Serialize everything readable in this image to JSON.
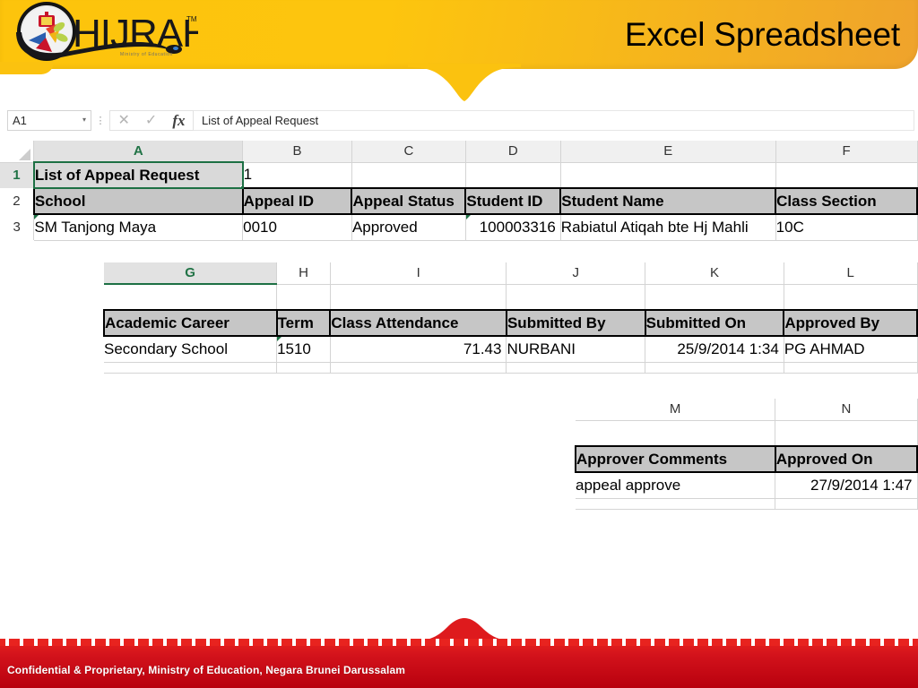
{
  "header": {
    "logo_text": "HIJRAH",
    "logo_tagline": "Ministry of Education",
    "logo_tm": "TM",
    "title": "Excel Spreadsheet",
    "bg_color_left": "#FDC40C",
    "bg_color_right": "#EFA32C"
  },
  "formula_bar": {
    "name_box_value": "A1",
    "name_box_caret": "▾",
    "dots_icon": "vertical-dots-icon",
    "cancel_icon": "✕",
    "enter_icon": "✓",
    "fx_icon": "fx",
    "formula_value": "List of Appeal Request"
  },
  "block1": {
    "column_headers": [
      "A",
      "B",
      "C",
      "D",
      "E",
      "F"
    ],
    "active_column": "A",
    "row_headers": [
      "1",
      "2",
      "3"
    ],
    "active_row": "1",
    "rows": [
      [
        "List of Appeal Request",
        "1",
        "",
        "",
        "",
        ""
      ],
      [
        "School",
        "Appeal ID",
        "Appeal Status",
        "Student ID",
        "Student Name",
        "Class Section"
      ],
      [
        "SM Tanjong Maya",
        "0010",
        "Approved",
        "100003316",
        "Rabiatul Atiqah bte Hj Mahli",
        "10C"
      ]
    ]
  },
  "block2": {
    "column_headers": [
      "G",
      "H",
      "I",
      "J",
      "K",
      "L"
    ],
    "active_column": "G",
    "rows": [
      [
        "",
        "",
        "",
        "",
        "",
        ""
      ],
      [
        "Academic Career",
        "Term",
        "Class Attendance",
        "Submitted By",
        "Submitted On",
        "Approved By"
      ],
      [
        "Secondary School",
        "1510",
        "71.43",
        "NURBANI",
        "25/9/2014 1:34",
        "PG AHMAD"
      ]
    ]
  },
  "block3": {
    "column_headers": [
      "M",
      "N"
    ],
    "rows": [
      [
        "",
        ""
      ],
      [
        "Approver Comments",
        "Approved On"
      ],
      [
        "appeal approve",
        "27/9/2014 1:47"
      ]
    ]
  },
  "footer": {
    "text": "Confidential & Proprietary, Ministry of Education, Negara Brunei Darussalam",
    "bg_color": "#D2121B"
  }
}
